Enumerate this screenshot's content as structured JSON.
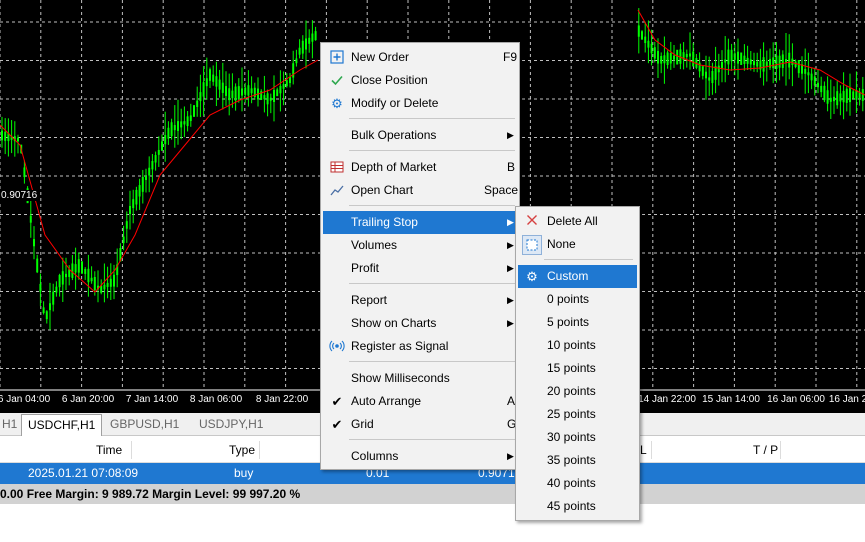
{
  "chart": {
    "price_label": "0.90716",
    "time_labels": [
      "6 Jan 04:00",
      "6 Jan 20:00",
      "7 Jan 14:00",
      "8 Jan 06:00",
      "8 Jan 22:00",
      "14 Jan 22:00",
      "15 Jan 14:00",
      "16 Jan 06:00",
      "16 Jan 2"
    ],
    "candle_color": "#00ff00",
    "ma_color": "#ff0000",
    "grid_color": "#c0c0c0"
  },
  "tabs": [
    "H1",
    "USDCHF,H1",
    "GBPUSD,H1",
    "USDJPY,H1"
  ],
  "table": {
    "headers": {
      "time": "Time",
      "type": "Type",
      "l": "L",
      "tp": "T / P"
    },
    "row": {
      "time": "2025.01.21 07:08:09",
      "type": "buy",
      "volume": "0.01",
      "price": "0.90719"
    },
    "status": "0.00  Free Margin: 9 989.72  Margin Level: 99 997.20 %"
  },
  "context_menu": {
    "items": [
      {
        "label": "New Order",
        "shortcut": "F9",
        "icon": "plus-box-icon"
      },
      {
        "label": "Close Position",
        "icon": "checkmark-icon"
      },
      {
        "label": "Modify or Delete",
        "icon": "gear-icon"
      },
      {
        "label": "Bulk Operations",
        "arrow": "▶"
      },
      {
        "label": "Depth of Market",
        "shortcut": "B",
        "icon": "depth-table-icon"
      },
      {
        "label": "Open Chart",
        "shortcut": "Space",
        "icon": "line-chart-icon"
      },
      {
        "label": "Trailing Stop",
        "arrow": "▶"
      },
      {
        "label": "Volumes",
        "arrow": "▶"
      },
      {
        "label": "Profit",
        "arrow": "▶"
      },
      {
        "label": "Report",
        "arrow": "▶"
      },
      {
        "label": "Show on Charts",
        "arrow": "▶"
      },
      {
        "label": "Register as Signal",
        "icon": "signal-broadcast-icon"
      },
      {
        "label": "Show Milliseconds"
      },
      {
        "label": "Auto Arrange",
        "shortcut": "A",
        "check": "✔"
      },
      {
        "label": "Grid",
        "shortcut": "G",
        "check": "✔"
      },
      {
        "label": "Columns",
        "arrow": "▶"
      }
    ]
  },
  "trailing_submenu": {
    "items": [
      {
        "label": "Delete All",
        "icon": "x-icon"
      },
      {
        "label": "None",
        "icon": "empty-box-icon"
      },
      {
        "label": "Custom",
        "icon": "gear-icon"
      },
      {
        "label": "0 points"
      },
      {
        "label": "5 points"
      },
      {
        "label": "10 points"
      },
      {
        "label": "15 points"
      },
      {
        "label": "20 points"
      },
      {
        "label": "25 points"
      },
      {
        "label": "30 points"
      },
      {
        "label": "35 points"
      },
      {
        "label": "40 points"
      },
      {
        "label": "45 points"
      }
    ]
  }
}
